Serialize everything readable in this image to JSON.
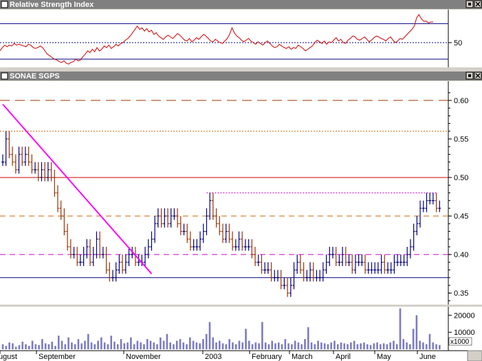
{
  "colors": {
    "panel_bg": "#ffffff",
    "frame_bg": "#d4d0c8",
    "titlebar": "#808080",
    "rsi_line": "#cc0000",
    "up_bar": "#000080",
    "down_bar": "#993300",
    "trendline": "#ff00ff",
    "volume_bar": "#7b7bc4",
    "support_blue": "#000080",
    "resist_red": "#cc0000",
    "dash_magenta": "#cc00cc",
    "dash_orange": "#cc6600",
    "dash_brown": "#993300"
  },
  "chart_data": [
    {
      "type": "line",
      "title": "Relative Strength Index",
      "y_ticks": [
        50
      ],
      "ylim": [
        20,
        90
      ],
      "reference_lines": [
        {
          "value": 73,
          "style": "solid",
          "color": "#000080"
        },
        {
          "value": 50,
          "style": "dotted",
          "color": "#000080"
        },
        {
          "value": 30,
          "style": "solid",
          "color": "#000080"
        }
      ],
      "series": [
        {
          "values": [
            40,
            44,
            47,
            45,
            47,
            46,
            49,
            47,
            48,
            47,
            46,
            45,
            48,
            47,
            44,
            43,
            44,
            46,
            44,
            40,
            36,
            34,
            32,
            30,
            29,
            27,
            26,
            28,
            25,
            24,
            26,
            27,
            30,
            28,
            29,
            33,
            36,
            40,
            38,
            42,
            39,
            44,
            40,
            42,
            46,
            44,
            47,
            43,
            45,
            48,
            46,
            49,
            50,
            53,
            55,
            58,
            62,
            66,
            70,
            66,
            68,
            64,
            67,
            63,
            65,
            60,
            62,
            58,
            56,
            54,
            57,
            59,
            57,
            55,
            58,
            61,
            59,
            56,
            53,
            52,
            55,
            51,
            53,
            56,
            54,
            57,
            60,
            58,
            55,
            52,
            51,
            54,
            52,
            50,
            49,
            52,
            55,
            60,
            68,
            62,
            58,
            56,
            53,
            51,
            53,
            55,
            52,
            50,
            48,
            51,
            49,
            47,
            50,
            52,
            49,
            46,
            44,
            45,
            48,
            46,
            44,
            43,
            45,
            42,
            44,
            43,
            47,
            45,
            43,
            40,
            42,
            44,
            46,
            50,
            53,
            51,
            49,
            52,
            48,
            51,
            50,
            53,
            56,
            52,
            54,
            50,
            49,
            53,
            55,
            58,
            57,
            54,
            53,
            55,
            57,
            54,
            51,
            53,
            56,
            58,
            57,
            55,
            54,
            52,
            55,
            57,
            53,
            50,
            52,
            55,
            54,
            57,
            60,
            63,
            66,
            70,
            80,
            84,
            79,
            76,
            76,
            74,
            75,
            75
          ]
        }
      ]
    },
    {
      "type": "ohlc",
      "title": "SONAE SGPS",
      "y_ticks": [
        0.6,
        0.55,
        0.5,
        0.45,
        0.4,
        0.35
      ],
      "y_tick_labels": [
        "0.60",
        "0.55",
        "0.50",
        "0.45",
        "0.40",
        "0.35"
      ],
      "ylim": [
        0.335,
        0.625
      ],
      "x_labels": [
        "ugust",
        "September",
        "November",
        "2003",
        "February",
        "March",
        "April",
        "May",
        "June"
      ],
      "reference_lines": [
        {
          "value": 0.6,
          "style": "longdash",
          "color": "#993300"
        },
        {
          "value": 0.56,
          "style": "dotted",
          "color": "#cc6600"
        },
        {
          "value": 0.5,
          "style": "solid",
          "color": "#cc0000"
        },
        {
          "value": 0.48,
          "style": "dotted",
          "color": "#cc00cc",
          "from_index": 63
        },
        {
          "value": 0.45,
          "style": "dashed",
          "color": "#cc6600"
        },
        {
          "value": 0.4,
          "style": "dashed",
          "color": "#cc00cc"
        },
        {
          "value": 0.37,
          "style": "solid",
          "color": "#000080"
        }
      ],
      "trendline": {
        "from": [
          0,
          0.595
        ],
        "to": [
          46,
          0.375
        ]
      },
      "close": [
        0.52,
        0.55,
        0.53,
        0.52,
        0.51,
        0.53,
        0.52,
        0.53,
        0.52,
        0.51,
        0.51,
        0.5,
        0.51,
        0.5,
        0.51,
        0.5,
        0.48,
        0.46,
        0.45,
        0.43,
        0.41,
        0.4,
        0.4,
        0.39,
        0.39,
        0.4,
        0.41,
        0.39,
        0.4,
        0.42,
        0.4,
        0.4,
        0.38,
        0.37,
        0.37,
        0.38,
        0.39,
        0.38,
        0.39,
        0.4,
        0.4,
        0.39,
        0.39,
        0.39,
        0.4,
        0.41,
        0.42,
        0.44,
        0.45,
        0.44,
        0.45,
        0.44,
        0.45,
        0.45,
        0.44,
        0.43,
        0.43,
        0.42,
        0.41,
        0.41,
        0.41,
        0.42,
        0.43,
        0.45,
        0.47,
        0.45,
        0.44,
        0.43,
        0.42,
        0.43,
        0.42,
        0.41,
        0.41,
        0.42,
        0.41,
        0.41,
        0.41,
        0.4,
        0.39,
        0.39,
        0.38,
        0.38,
        0.38,
        0.37,
        0.37,
        0.37,
        0.36,
        0.36,
        0.35,
        0.36,
        0.38,
        0.39,
        0.38,
        0.37,
        0.37,
        0.38,
        0.37,
        0.37,
        0.37,
        0.38,
        0.39,
        0.4,
        0.4,
        0.39,
        0.39,
        0.4,
        0.39,
        0.39,
        0.38,
        0.39,
        0.39,
        0.39,
        0.38,
        0.38,
        0.38,
        0.38,
        0.38,
        0.39,
        0.38,
        0.38,
        0.38,
        0.39,
        0.39,
        0.39,
        0.39,
        0.4,
        0.41,
        0.43,
        0.44,
        0.46,
        0.46,
        0.47,
        0.47,
        0.47,
        0.46,
        0.46
      ],
      "volume": {
        "y_ticks": [
          20000,
          10000
        ],
        "y_tick_labels": [
          "20000",
          "10000"
        ],
        "multiplier_label": "x1000",
        "ylim": [
          0,
          25000
        ],
        "values": [
          3000,
          2000,
          4000,
          3500,
          1500,
          2500,
          4500,
          3000,
          2000,
          5000,
          3000,
          2500,
          6000,
          3500,
          3000,
          4500,
          2000,
          8000,
          5000,
          3000,
          7000,
          4000,
          3000,
          6000,
          3500,
          5000,
          9000,
          4000,
          3000,
          5000,
          7000,
          4000,
          3000,
          8000,
          4500,
          3000,
          6000,
          3500,
          4000,
          7000,
          3000,
          5000,
          4000,
          3000,
          6000,
          5000,
          4000,
          3000,
          7000,
          5000,
          9000,
          4000,
          3000,
          5000,
          6000,
          4000,
          3000,
          7000,
          5000,
          4000,
          3500,
          6000,
          9000,
          16000,
          7000,
          4000,
          5000,
          3500,
          3000,
          6000,
          4000,
          3000,
          5000,
          4000,
          12000,
          5000,
          3000,
          4000,
          3500,
          16000,
          4000,
          3000,
          5000,
          3500,
          4000,
          3000,
          6000,
          3500,
          3000,
          5000,
          4000,
          3000,
          6000,
          13000,
          4000,
          3000,
          5000,
          4000,
          3500,
          3000,
          4000,
          5000,
          3000,
          4000,
          3500,
          3000,
          4000,
          5000,
          3000,
          3500,
          4000,
          3000,
          2500,
          3500,
          4000,
          3000,
          3500,
          3000,
          4000,
          5000,
          3000,
          24000,
          6000,
          4000,
          3000,
          12000,
          20000,
          5000,
          4000,
          3000,
          9000,
          4000,
          3000,
          2500
        ]
      }
    }
  ]
}
